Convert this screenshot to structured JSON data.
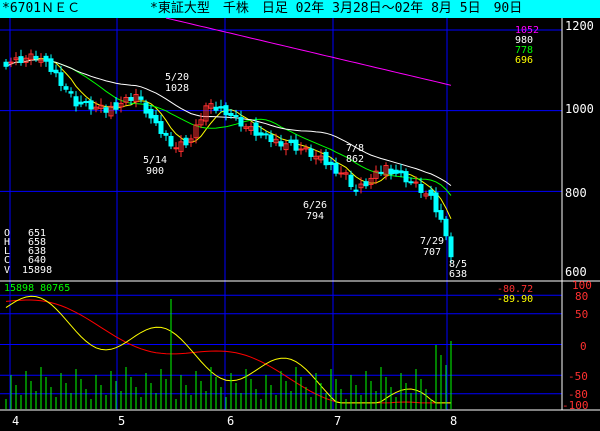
{
  "header": {
    "code": "*6701ＮＥＣ",
    "info": "*東証大型　千株　日足 02年 3月28日〜02年 8月 5日　90日"
  },
  "colors": {
    "title_bg": "#00ffff",
    "grid": "#0000ff",
    "panel_border": "#ffffff",
    "candle_up": "#ff3030",
    "candle_down": "#00ffff",
    "ma_fast": "#ffff00",
    "ma_mid": "#00ff00",
    "ma_slow": "#ffffff",
    "ma_long": "#ff00ff",
    "volume": "#00ff00",
    "osc_red": "#ff0000",
    "osc_yellow": "#ffff00"
  },
  "ohlcv": {
    "open": "651",
    "high": "658",
    "low": "638",
    "close": "640",
    "volume": "15898"
  },
  "ma_values": [
    "1052",
    "980",
    "778",
    "696"
  ],
  "volume_readout": "15898 80765",
  "osc_values": [
    "-80.72",
    "-89.90"
  ],
  "month_labels": [
    "4",
    "5",
    "6",
    "7",
    "8"
  ],
  "chart_data": {
    "type": "candlestick",
    "price_axis": {
      "ticks": [
        "1200",
        "1000",
        "800",
        "600"
      ],
      "range": [
        600,
        1200
      ]
    },
    "oscillator_axis": {
      "ticks": [
        "100",
        "80",
        "50",
        "0",
        "-50",
        "-80",
        "-100"
      ],
      "range": [
        -100,
        100
      ]
    },
    "annotations": [
      {
        "date": "5/20",
        "value": "1028"
      },
      {
        "date": "5/14",
        "value": "900"
      },
      {
        "date": "7/8",
        "value": "862"
      },
      {
        "date": "6/26",
        "value": "794"
      },
      {
        "date": "7/29",
        "value": "707"
      },
      {
        "date": "8/5",
        "value": "638"
      }
    ]
  }
}
